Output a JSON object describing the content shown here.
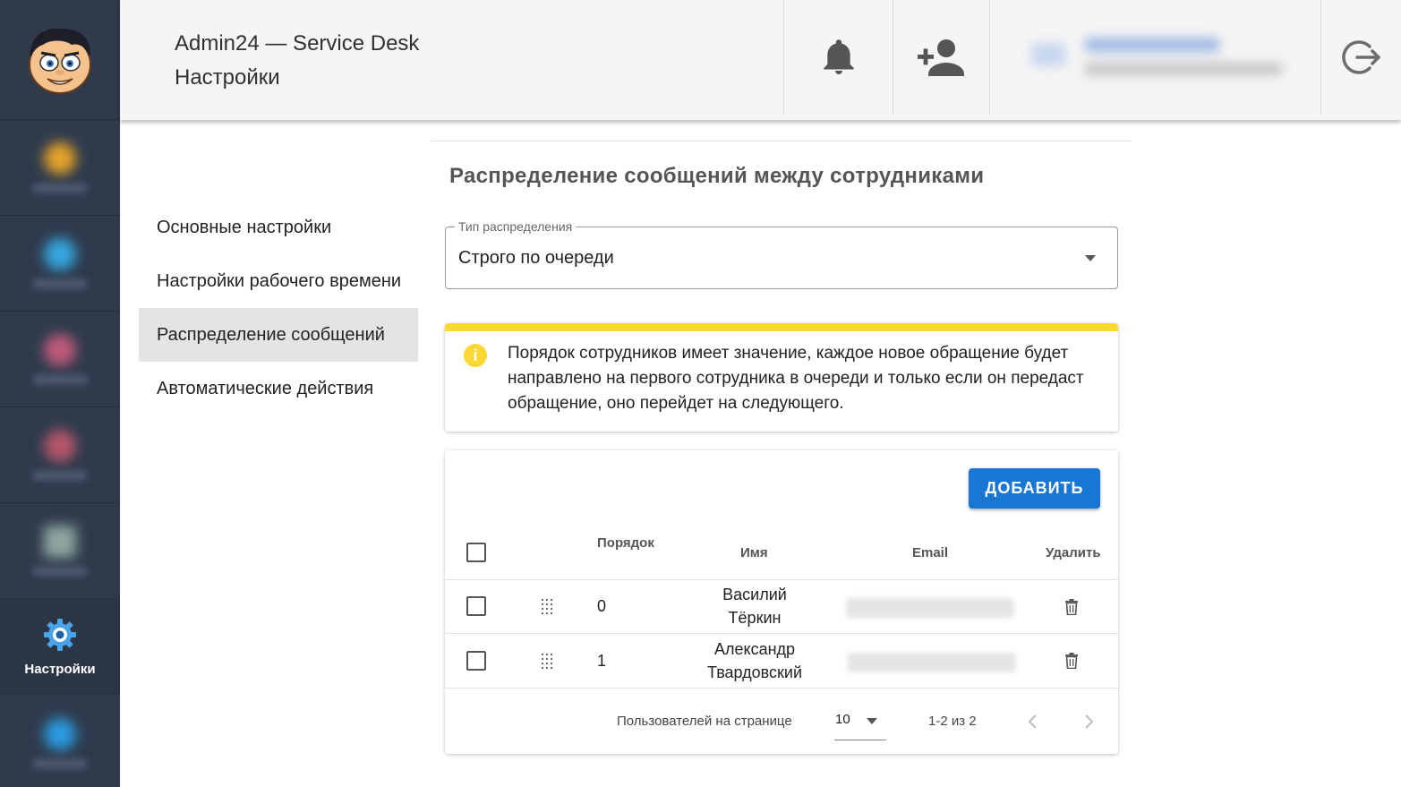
{
  "header": {
    "app_title": "Admin24 — Service Desk",
    "page_title": "Настройки"
  },
  "sidebar": {
    "active_label": "Настройки"
  },
  "settings_menu": [
    {
      "label": "Основные настройки",
      "active": false
    },
    {
      "label": "Настройки рабочего времени",
      "active": false
    },
    {
      "label": "Распределение сообщений",
      "active": true
    },
    {
      "label": "Автоматические действия",
      "active": false
    }
  ],
  "section": {
    "title": "Распределение сообщений между сотрудниками"
  },
  "distribution_select": {
    "label": "Тип распределения",
    "value": "Строго по очереди"
  },
  "alert": {
    "text": "Порядок сотрудников имеет значение, каждое новое обращение будет направлено на первого сотрудника в очереди и только если он передаст обращение, оно перейдет на следующего."
  },
  "table": {
    "add_button": "ДОБАВИТЬ",
    "columns": {
      "order": "Порядок",
      "name": "Имя",
      "email": "Email",
      "delete": "Удалить"
    },
    "rows": [
      {
        "order": "0",
        "name_first": "Василий",
        "name_last": "Тёркин"
      },
      {
        "order": "1",
        "name_first": "Александр",
        "name_last": "Твардовский"
      }
    ],
    "footer": {
      "per_page_label": "Пользователей на странице",
      "per_page_value": "10",
      "range": "1-2 из 2"
    }
  },
  "colors": {
    "sidebar_bg": "#2f3b4d",
    "accent": "#1976d2",
    "alert_yellow": "#fdd835"
  }
}
